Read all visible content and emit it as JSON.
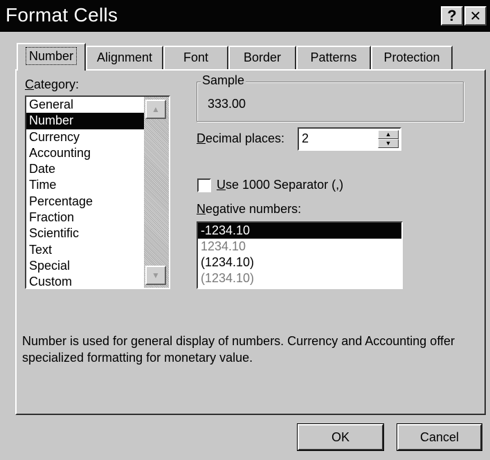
{
  "window": {
    "title": "Format Cells",
    "help_glyph": "?",
    "close_glyph": "✕"
  },
  "tabs": [
    {
      "label": "Number",
      "active": true
    },
    {
      "label": "Alignment",
      "active": false
    },
    {
      "label": "Font",
      "active": false
    },
    {
      "label": "Border",
      "active": false
    },
    {
      "label": "Patterns",
      "active": false
    },
    {
      "label": "Protection",
      "active": false
    }
  ],
  "category": {
    "label_mnemonic": "C",
    "label_rest": "ategory:",
    "items": [
      "General",
      "Number",
      "Currency",
      "Accounting",
      "Date",
      "Time",
      "Percentage",
      "Fraction",
      "Scientific",
      "Text",
      "Special",
      "Custom"
    ],
    "selected": "Number"
  },
  "sample": {
    "legend": "Sample",
    "value": "333.00"
  },
  "decimal_places": {
    "label_mnemonic": "D",
    "label_rest": "ecimal places:",
    "value": "2"
  },
  "separator": {
    "label_mnemonic": "U",
    "label_rest": "se 1000 Separator (,)",
    "checked": false
  },
  "negative_numbers": {
    "label_mnemonic": "N",
    "label_rest": "egative numbers:",
    "items": [
      "-1234.10",
      "1234.10",
      "(1234.10)",
      "(1234.10)"
    ],
    "selected": "-1234.10"
  },
  "description": "Number is used for general display of numbers.  Currency and Accounting offer specialized formatting for monetary value.",
  "buttons": {
    "ok": "OK",
    "cancel": "Cancel"
  },
  "icons": {
    "scroll_up": "scroll-up-arrow-icon",
    "scroll_down": "scroll-down-arrow-icon",
    "spin_up": "spin-up-arrow-icon",
    "spin_down": "spin-down-arrow-icon"
  }
}
